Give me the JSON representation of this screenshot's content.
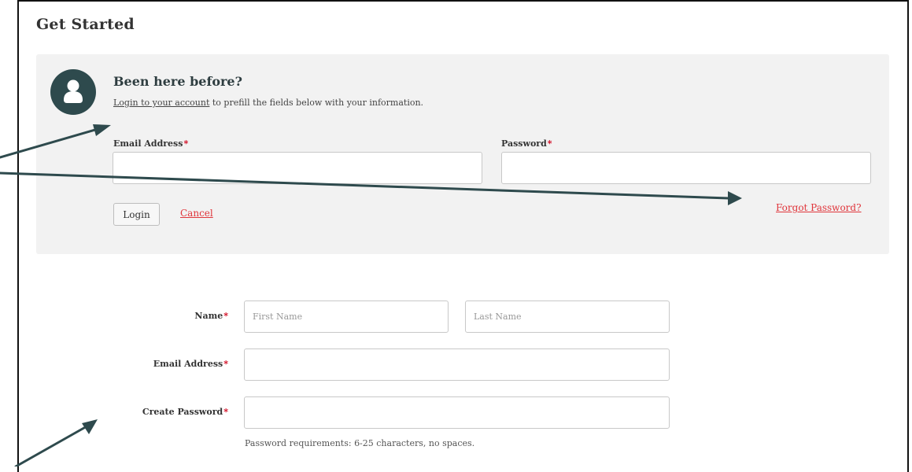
{
  "page": {
    "title": "Get Started"
  },
  "login_panel": {
    "heading": "Been here before?",
    "login_link": "Login to your account",
    "subtext": " to prefill the fields below with your information.",
    "email_label": "Email Address",
    "password_label": "Password",
    "required_marker": "*",
    "email_value": "",
    "password_value": "",
    "login_button": "Login",
    "cancel_link": "Cancel",
    "forgot_link": "Forgot Password?"
  },
  "signup_form": {
    "name_label": "Name",
    "first_name_placeholder": "First Name",
    "last_name_placeholder": "Last Name",
    "email_label": "Email Address",
    "password_label": "Create Password",
    "required_marker": "*",
    "password_hint": "Password requirements: 6-25 characters, no spaces."
  },
  "icons": {
    "avatar": "user-icon",
    "annotation": "arrow-icon"
  },
  "colors": {
    "avatar_bg": "#2e4a4d",
    "panel_bg": "#f2f2f2",
    "link_red": "#e0353b",
    "required_red": "#d0021b",
    "annotation_arrow": "#2e4a4d"
  }
}
